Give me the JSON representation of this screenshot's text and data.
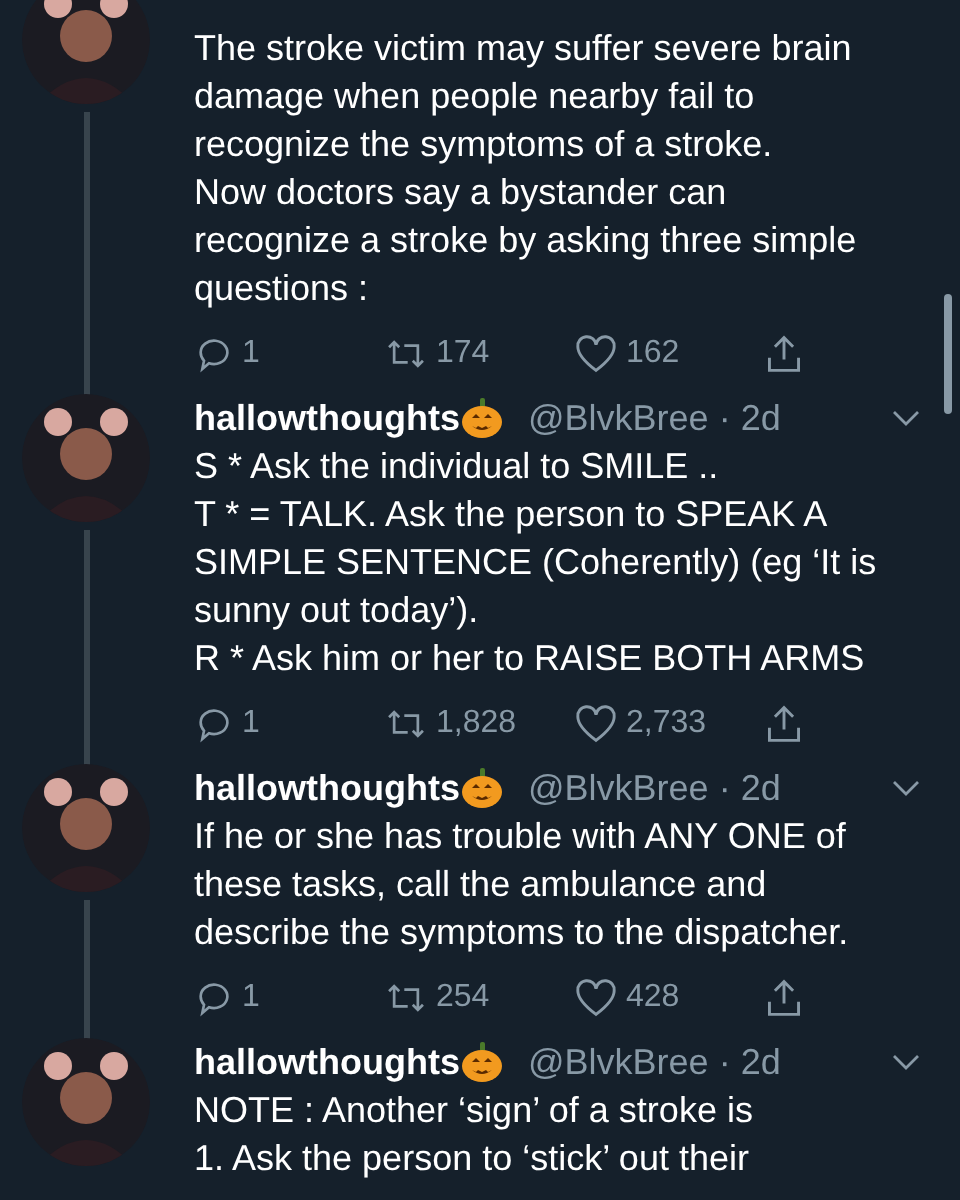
{
  "tweets": [
    {
      "text": [
        "The stroke victim may suffer severe brain",
        "damage when people nearby fail to",
        "recognize the symptoms of a stroke.",
        "Now doctors say a bystander can",
        "recognize a stroke by asking three simple",
        "questions :"
      ],
      "replies": "1",
      "retweets": "174",
      "likes": "162"
    },
    {
      "name": "hallowthoughts",
      "handle": "@BlvkBree",
      "sep": "·",
      "time": "2d",
      "text": [
        "S * Ask the individual to SMILE ..",
        "T * = TALK. Ask the person to SPEAK A",
        "SIMPLE SENTENCE (Coherently) (eg ‘It is",
        "sunny out today’).",
        "R * Ask him or her to RAISE BOTH ARMS"
      ],
      "replies": "1",
      "retweets": "1,828",
      "likes": "2,733"
    },
    {
      "name": "hallowthoughts",
      "handle": "@BlvkBree",
      "sep": "·",
      "time": "2d",
      "text": [
        "If he or she has trouble with ANY ONE of",
        "these tasks, call the ambulance and",
        "describe the symptoms to the dispatcher."
      ],
      "replies": "1",
      "retweets": "254",
      "likes": "428"
    },
    {
      "name": "hallowthoughts",
      "handle": "@BlvkBree",
      "sep": "·",
      "time": "2d",
      "text": [
        "NOTE : Another ‘sign’ of a stroke is",
        "1. Ask the person to ‘stick’ out their"
      ]
    }
  ]
}
